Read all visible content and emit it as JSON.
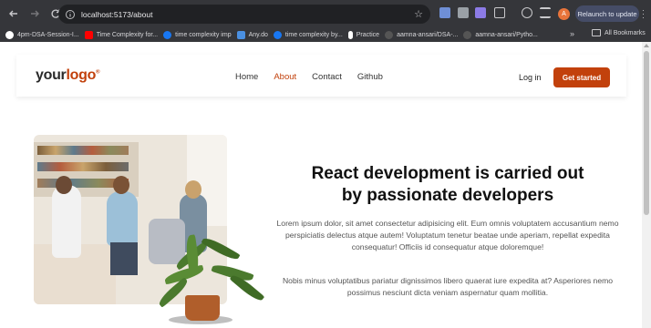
{
  "browser": {
    "url": "localhost:5173/about",
    "profile_initial": "A",
    "relaunch_label": "Relaunch to update",
    "bookmarks": [
      {
        "label": "4pm-DSA-Session-I...",
        "icon": "github-icon",
        "color": "#ffffff"
      },
      {
        "label": "Time Complexity for...",
        "icon": "youtube-icon",
        "color": "#ff0000"
      },
      {
        "label": "time complexity imp",
        "icon": "facebook-icon",
        "color": "#1877f2"
      },
      {
        "label": "Any.do",
        "icon": "anydo-icon",
        "color": "#4a90e2"
      },
      {
        "label": "time complexity by...",
        "icon": "facebook-icon",
        "color": "#1877f2"
      },
      {
        "label": "Practice",
        "icon": "mic-icon",
        "color": "#ffffff"
      },
      {
        "label": "aamna-ansari/DSA-...",
        "icon": "github-icon",
        "color": "#444444"
      },
      {
        "label": "aamna-ansari/Pytho...",
        "icon": "github-icon",
        "color": "#444444"
      }
    ],
    "more_bookmarks": "»",
    "all_bookmarks": "All Bookmarks"
  },
  "navbar": {
    "logo_part1": "your",
    "logo_part2": "logo",
    "links": [
      "Home",
      "About",
      "Contact",
      "Github"
    ],
    "active_link": "About",
    "login": "Log in",
    "cta": "Get started"
  },
  "hero": {
    "headline_line1": "React development is carried out",
    "headline_line2": "by passionate developers",
    "paragraph1": "Lorem ipsum dolor, sit amet consectetur adipisicing elit. Eum omnis voluptatem accusantium nemo perspiciatis delectus atque autem! Voluptatum tenetur beatae unde aperiam, repellat expedita consequatur! Officiis id consequatur atque doloremque!",
    "paragraph2": "Nobis minus voluptatibus pariatur dignissimos libero quaerat iure expedita at? Asperiores nemo possimus nesciunt dicta veniam aspernatur quam mollitia."
  },
  "colors": {
    "accent": "#c2410c",
    "chrome": "#35363a"
  }
}
